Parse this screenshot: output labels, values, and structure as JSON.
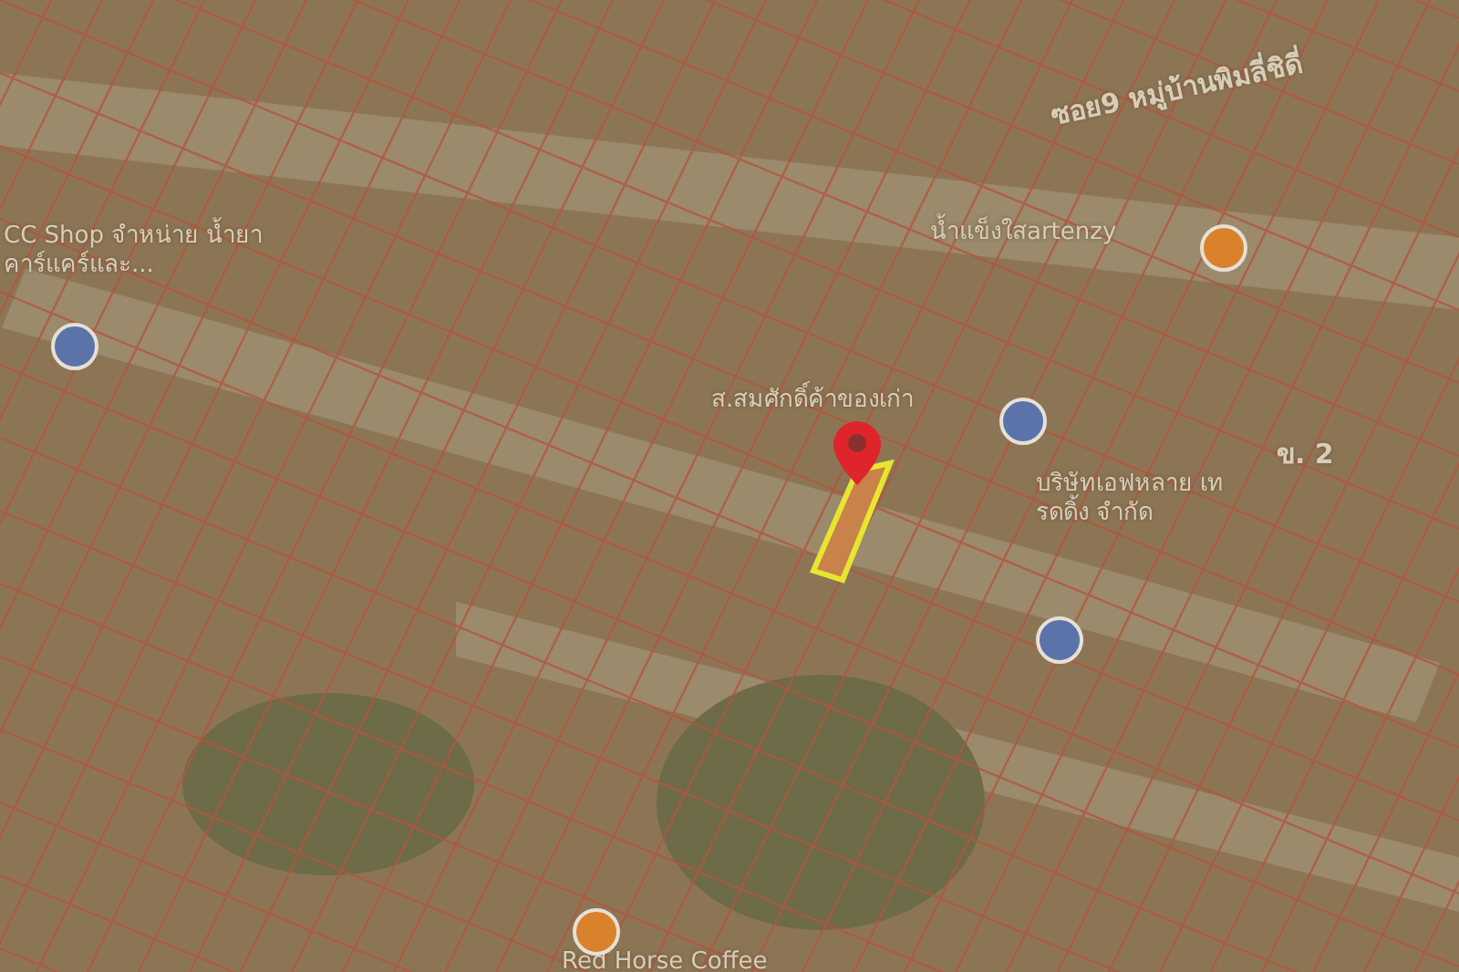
{
  "map": {
    "labels": [
      {
        "kind": "road",
        "text": "ซอย9 หมู่บ้านพิมลี่ชิดี่"
      },
      {
        "kind": "place",
        "text": "น้ำแข็งใสartenzy"
      },
      {
        "kind": "place",
        "text": "ส.สมศักดิ์ค้าของเก่า"
      },
      {
        "kind": "road",
        "text": "ข. 2"
      },
      {
        "kind": "place",
        "text": "CC Shop จำหน่าย น้ำยาคาร์แคร์และ..."
      },
      {
        "kind": "place",
        "text": "บริษัทเอฟหลาย เทรดดิ้ง จำกัด"
      },
      {
        "kind": "place",
        "text": "Red Horse Coffee"
      }
    ]
  }
}
